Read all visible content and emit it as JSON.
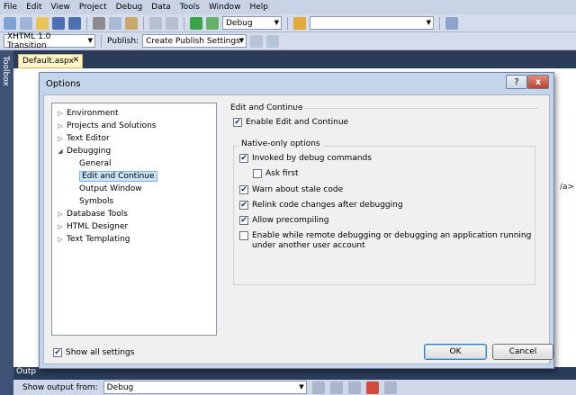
{
  "menu": [
    "File",
    "Edit",
    "View",
    "Project",
    "Debug",
    "Data",
    "Tools",
    "Window",
    "Help"
  ],
  "toolbar": {
    "config_value": "Debug",
    "search_value": "",
    "schema_value": "XHTML 1.0 Transition",
    "publish_label": "Publish:",
    "publish_value": "Create Publish Settings"
  },
  "toolbox_label": "Toolbox",
  "document_tab": "Default.aspx",
  "editor_hint": "/a>",
  "output": {
    "tab_label": "Outp",
    "show_label": "Show output from:",
    "source_value": "Debug"
  },
  "dialog": {
    "title": "Options",
    "help_glyph": "?",
    "close_glyph": "x",
    "tree": [
      {
        "label": "Environment",
        "level": 0,
        "expander": "▷"
      },
      {
        "label": "Projects and Solutions",
        "level": 0,
        "expander": "▷"
      },
      {
        "label": "Text Editor",
        "level": 0,
        "expander": "▷"
      },
      {
        "label": "Debugging",
        "level": 0,
        "expander": "◢"
      },
      {
        "label": "General",
        "level": 1,
        "expander": ""
      },
      {
        "label": "Edit and Continue",
        "level": 1,
        "expander": "",
        "selected": true
      },
      {
        "label": "Output Window",
        "level": 1,
        "expander": ""
      },
      {
        "label": "Symbols",
        "level": 1,
        "expander": ""
      },
      {
        "label": "Database Tools",
        "level": 0,
        "expander": "▷"
      },
      {
        "label": "HTML Designer",
        "level": 0,
        "expander": "▷"
      },
      {
        "label": "Text Templating",
        "level": 0,
        "expander": "▷"
      }
    ],
    "group_title": "Edit and Continue",
    "enable_label": "Enable Edit and Continue",
    "enable_checked": true,
    "native_title": "Native-only options",
    "native_options": [
      {
        "label": "Invoked by debug commands",
        "checked": true
      },
      {
        "label": "Ask first",
        "checked": false
      },
      {
        "label": "Warn about stale code",
        "checked": true
      },
      {
        "label": "Relink code changes after debugging",
        "checked": true
      },
      {
        "label": "Allow precompiling",
        "checked": true
      },
      {
        "label": "Enable while remote debugging or debugging an application running under another user account",
        "checked": false
      }
    ],
    "show_all_label": "Show all settings",
    "show_all_checked": true,
    "ok_label": "OK",
    "cancel_label": "Cancel"
  },
  "colors": {
    "ide_bg": "#2b3c59",
    "dialog_frame": "#c4d4ea",
    "selection": "#cde4f7"
  }
}
